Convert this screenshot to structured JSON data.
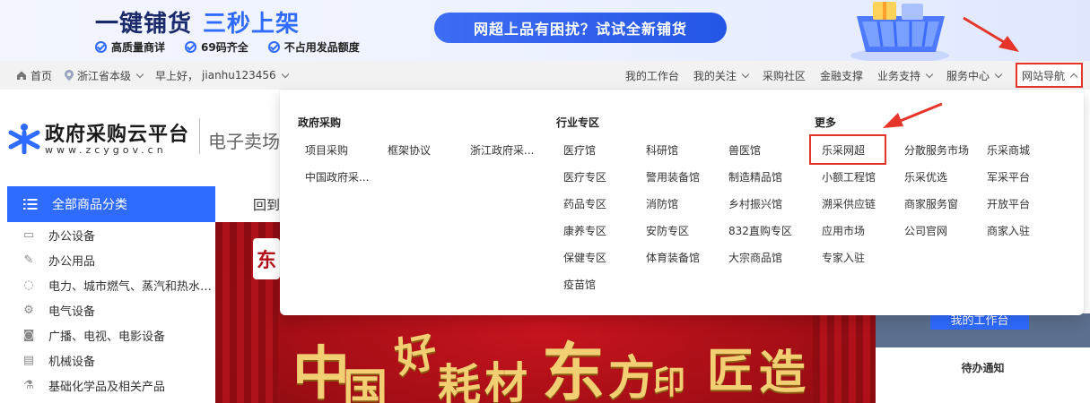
{
  "banner": {
    "title_part1": "一键铺货",
    "title_part2": "三秒上架",
    "features": [
      "高质量商详",
      "69码齐全",
      "不占用发品额度"
    ],
    "cta": "网超上品有困扰？试试全新铺货"
  },
  "topnav": {
    "home": "首页",
    "region": "浙江省本级",
    "greeting": "早上好，",
    "username": "jianhu123456",
    "right_items": [
      {
        "label": "我的工作台",
        "has_dropdown": false
      },
      {
        "label": "我的关注",
        "has_dropdown": true
      },
      {
        "label": "采购社区",
        "has_dropdown": false
      },
      {
        "label": "金融支撑",
        "has_dropdown": false
      },
      {
        "label": "业务支持",
        "has_dropdown": true
      },
      {
        "label": "服务中心",
        "has_dropdown": true
      }
    ],
    "site_nav": "网站导航"
  },
  "logo": {
    "title": "政府采购云平台",
    "subtitle": "www.zcygov.cn",
    "section": "电子卖场"
  },
  "categories": {
    "header": "全部商品分类",
    "items": [
      {
        "label": "办公设备",
        "icon": "printer-icon",
        "glyph": "▭"
      },
      {
        "label": "办公用品",
        "icon": "pen-icon",
        "glyph": "✎"
      },
      {
        "label": "电力、城市燃气、蒸汽和热水的生产和供应",
        "icon": "flame-icon",
        "glyph": "◌"
      },
      {
        "label": "电气设备",
        "icon": "gear-icon",
        "glyph": "⚙"
      },
      {
        "label": "广播、电视、电影设备",
        "icon": "camera-icon",
        "glyph": "◙"
      },
      {
        "label": "机械设备",
        "icon": "machine-icon",
        "glyph": "▤"
      },
      {
        "label": "基础化学品及相关产品",
        "icon": "flask-icon",
        "glyph": "⚗"
      }
    ]
  },
  "back_tab": "回到",
  "dropdown": {
    "sections": [
      {
        "title": "政府采购",
        "links": [
          "项目采购",
          "框架协议",
          "浙江政府采...",
          "中国政府采..."
        ]
      },
      {
        "title": "行业专区",
        "links": [
          "医疗馆",
          "科研馆",
          "兽医馆",
          "医疗专区",
          "警用装备馆",
          "制造精品馆",
          "药品专区",
          "消防馆",
          "乡村振兴馆",
          "康养专区",
          "安防专区",
          "832直购专区",
          "保健专区",
          "体育装备馆",
          "大宗商品馆",
          "疫苗馆"
        ]
      },
      {
        "title": "更多",
        "links": [
          "乐采网超",
          "分散服务市场",
          "乐采商城",
          "小额工程馆",
          "乐采优选",
          "军采平台",
          "溯采供应链",
          "商家服务窗",
          "开放平台",
          "应用市场",
          "公司官网",
          "商家入驻",
          "专家入驻"
        ]
      }
    ]
  },
  "hero": {
    "seal_text": "东",
    "calligraphy": [
      "中",
      "国",
      "好",
      "耗",
      "材",
      "东",
      "方",
      "印",
      "匠",
      "造"
    ]
  },
  "right_panel": {
    "workbench_button": "我的工作台",
    "notice_title": "待办通知"
  },
  "colors": {
    "brand_blue": "#2f6bff",
    "highlight_red": "#e5352b",
    "hero_red": "#b5121b",
    "gold": "#f3cf74"
  }
}
